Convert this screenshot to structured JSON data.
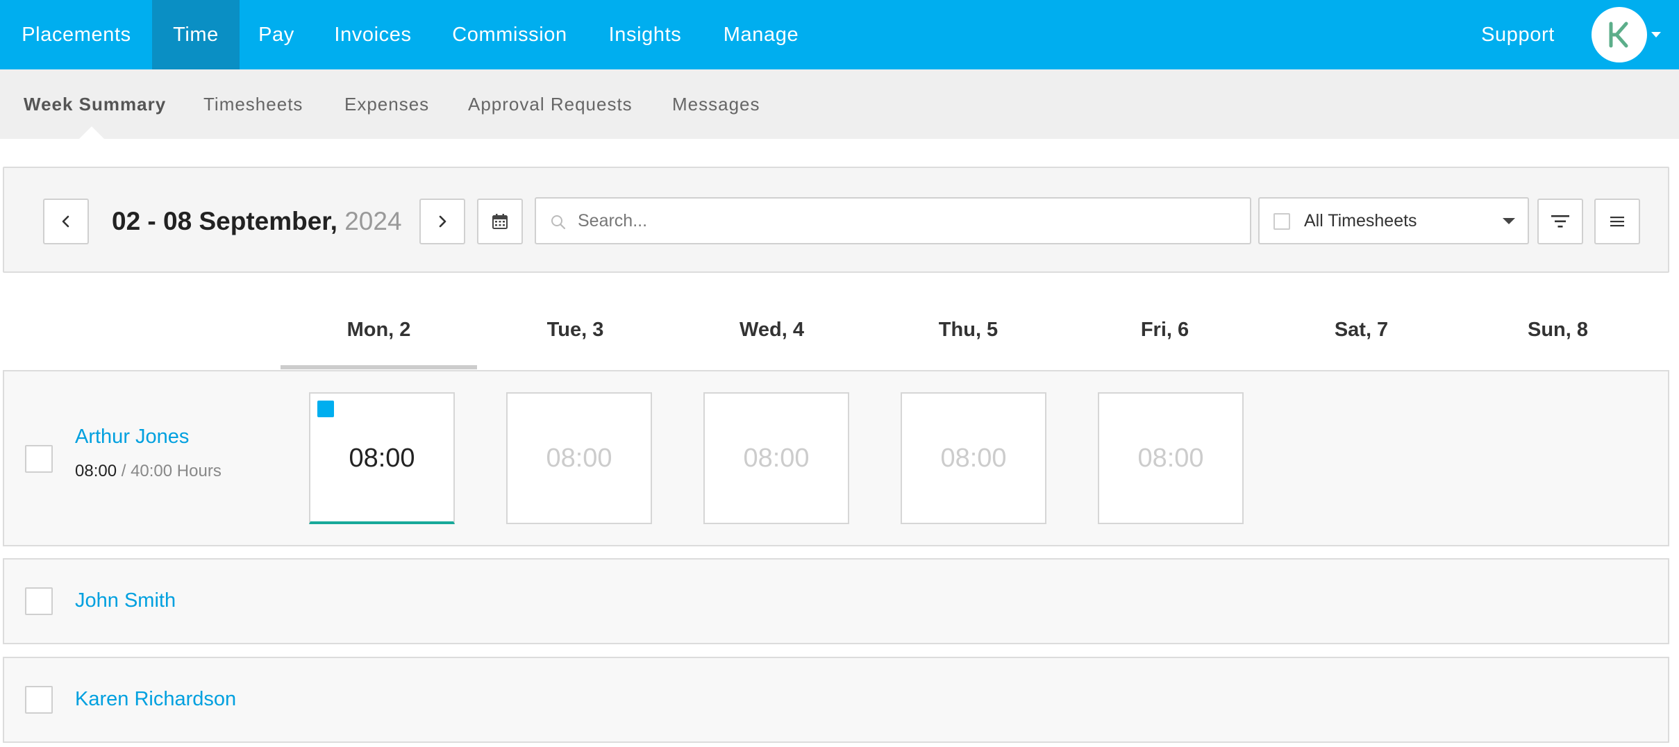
{
  "topnav": {
    "items": [
      {
        "label": "Placements",
        "active": false
      },
      {
        "label": "Time",
        "active": true
      },
      {
        "label": "Pay",
        "active": false
      },
      {
        "label": "Invoices",
        "active": false
      },
      {
        "label": "Commission",
        "active": false
      },
      {
        "label": "Insights",
        "active": false
      },
      {
        "label": "Manage",
        "active": false
      }
    ],
    "support_label": "Support",
    "brand_color": "#00aeef",
    "logo_color": "#5cae8a"
  },
  "subnav": {
    "items": [
      {
        "label": "Week Summary",
        "active": true
      },
      {
        "label": "Timesheets",
        "active": false
      },
      {
        "label": "Expenses",
        "active": false
      },
      {
        "label": "Approval Requests",
        "active": false
      },
      {
        "label": "Messages",
        "active": false
      }
    ]
  },
  "toolbar": {
    "week_range": "02 - 08 September,",
    "year": "2024",
    "search_placeholder": "Search...",
    "filter_select_label": "All Timesheets",
    "icons": [
      "chevron-left-icon",
      "chevron-right-icon",
      "calendar-icon",
      "search-icon",
      "filter-icon",
      "menu-icon"
    ]
  },
  "days": [
    {
      "label": "Mon, 2",
      "selected": true
    },
    {
      "label": "Tue, 3",
      "selected": false
    },
    {
      "label": "Wed, 4",
      "selected": false
    },
    {
      "label": "Thu, 5",
      "selected": false
    },
    {
      "label": "Fri, 6",
      "selected": false
    },
    {
      "label": "Sat, 7",
      "selected": false
    },
    {
      "label": "Sun, 8",
      "selected": false
    }
  ],
  "people": [
    {
      "name": "Arthur Jones",
      "hours_done": "08:00",
      "hours_total": "/ 40:00 Hours",
      "cells": [
        "08:00",
        "08:00",
        "08:00",
        "08:00",
        "08:00"
      ]
    },
    {
      "name": "John Smith"
    },
    {
      "name": "Karen Richardson"
    }
  ]
}
